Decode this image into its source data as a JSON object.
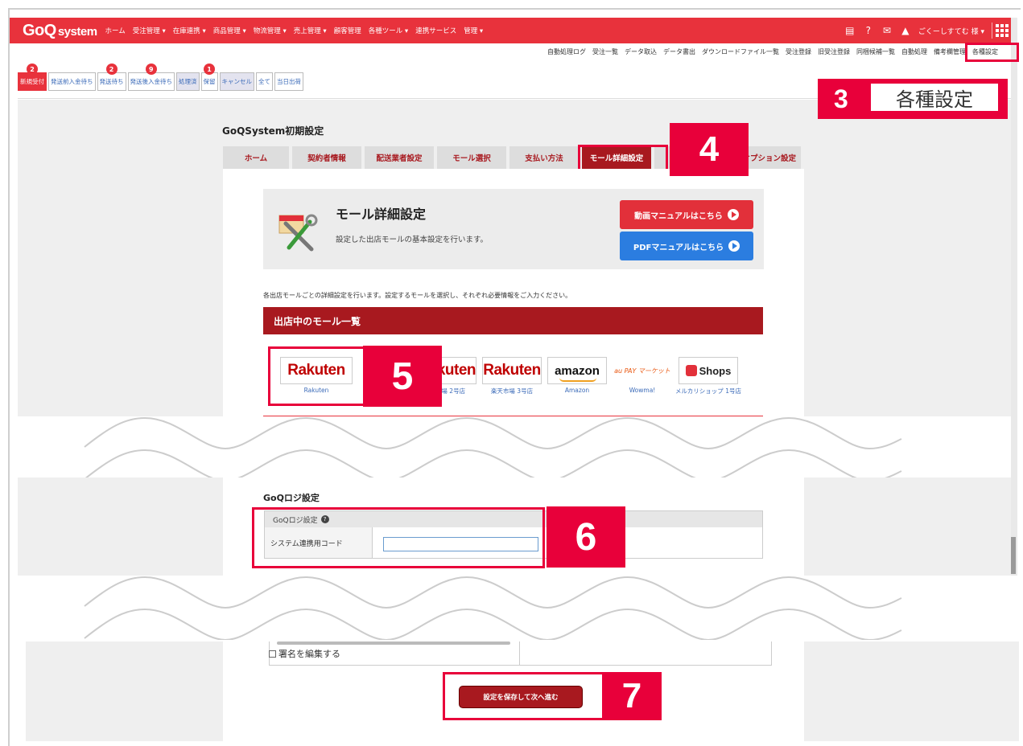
{
  "app": {
    "logo_main": "GoQ",
    "logo_sub": "system",
    "topnav": [
      "ホーム",
      "受注管理 ▾",
      "在庫連携 ▾",
      "商品管理 ▾",
      "物流管理 ▾",
      "売上管理 ▾",
      "顧客管理",
      "各種ツール ▾",
      "連携サービス",
      "管理 ▾"
    ],
    "user_label": "ごくーしすてむ 様 ▾"
  },
  "subnav": [
    "自動処理ログ",
    "受注一覧",
    "データ取込",
    "データ書出",
    "ダウンロードファイル一覧",
    "受注登録",
    "旧受注登録",
    "同梱候補一覧",
    "自動処理",
    "備考欄管理",
    "各種設定"
  ],
  "status_tabs": [
    {
      "label": "新規受付",
      "badge": "2"
    },
    {
      "label": "発送前入金待ち",
      "badge": ""
    },
    {
      "label": "発送待ち",
      "badge": "2"
    },
    {
      "label": "発送後入金待ち",
      "badge": "9"
    },
    {
      "label": "処理済",
      "badge": ""
    },
    {
      "label": "保留",
      "badge": "1"
    },
    {
      "label": "キャンセル",
      "badge": ""
    },
    {
      "label": "全て",
      "badge": ""
    },
    {
      "label": "当日出荷",
      "badge": ""
    }
  ],
  "page_title": "GoQSystem初期設定",
  "settings_tabs": [
    "ホーム",
    "契約者情報",
    "配送業者設定",
    "モール選択",
    "支払い方法",
    "モール詳細設定",
    "オプション設定"
  ],
  "hero": {
    "title": "モール詳細設定",
    "desc": "設定した出店モールの基本設定を行います。",
    "video_button": "動画マニュアルはこちら",
    "pdf_button": "PDFマニュアルはこちら"
  },
  "intro_text": "各出店モールごとの詳細設定を行います。設定するモールを選択し、それぞれ必要情報をご入力ください。",
  "mall_list_title": "出店中のモール一覧",
  "malls": [
    {
      "logo": "Rakuten",
      "label": "Rakuten"
    },
    {
      "logo": "Rakuten",
      "label": "楽天市場 2号店"
    },
    {
      "logo": "Rakuten",
      "label": "楽天市場 3号店"
    },
    {
      "logo": "amazon",
      "label": "Amazon"
    },
    {
      "logo": "au PAY マーケット",
      "label": "Wowma!"
    },
    {
      "logo": "Shops",
      "label": "メルカリショップ 1号店"
    }
  ],
  "logi": {
    "section_title": "GoQロジ設定",
    "table_header": "GoQロジ設定",
    "field_label": "システム連携用コード",
    "field_value": ""
  },
  "signature_checkbox": "署名を編集する",
  "save_button": "設定を保存して次へ進む",
  "callouts": {
    "n3": "3",
    "n3_label": "各種設定",
    "n4": "4",
    "n5": "5",
    "n6": "6",
    "n7": "7"
  },
  "colors": {
    "brand_red": "#e8323c",
    "dark_red": "#a8191f",
    "callout_red": "#e8003a",
    "link_blue": "#3a6ab8"
  }
}
